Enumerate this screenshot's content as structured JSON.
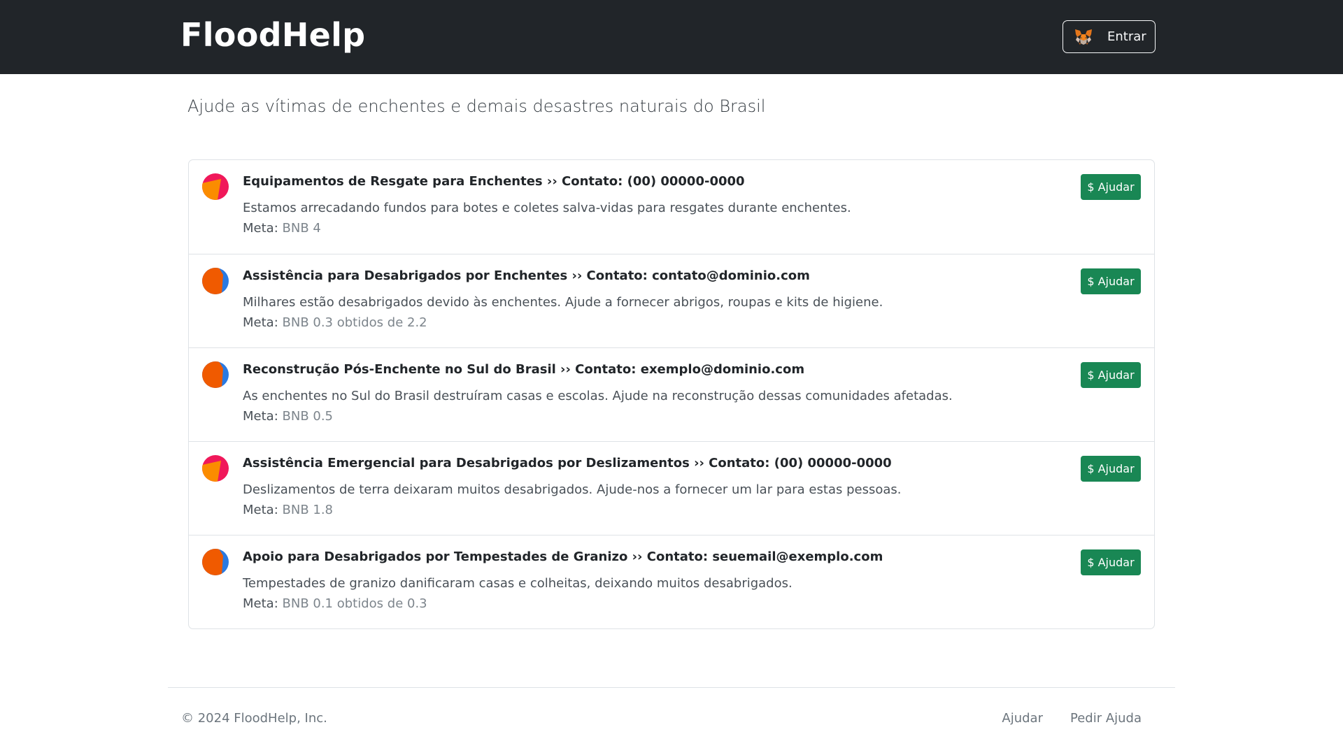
{
  "header": {
    "brand": "FloodHelp",
    "login_label": "Entrar",
    "login_icon": "metamask-fox-icon"
  },
  "tagline": "Ajude as vítimas de enchentes e demais desastres naturais do Brasil",
  "campaigns": [
    {
      "title": "Equipamentos de Resgate para Enchentes ›› Contato: (00) 00000-0000",
      "description": "Estamos arrecadando fundos para botes e coletes salva-vidas para resgates durante enchentes.",
      "goal_label": "Meta:",
      "goal_value": "BNB 4",
      "button_label": "$ Ajudar",
      "avatar_colors": [
        "#f0185a",
        "#fb8c00"
      ]
    },
    {
      "title": "Assistência para Desabrigados por Enchentes ›› Contato: contato@dominio.com",
      "description": "Milhares estão desabrigados devido às enchentes. Ajude a fornecer abrigos, roupas e kits de higiene.",
      "goal_label": "Meta:",
      "goal_value": "BNB 0.3 obtidos de 2.2",
      "button_label": "$ Ajudar",
      "avatar_colors": [
        "#f05a00",
        "#2a7ae2"
      ]
    },
    {
      "title": "Reconstrução Pós-Enchente no Sul do Brasil ›› Contato: exemplo@dominio.com",
      "description": "As enchentes no Sul do Brasil destruíram casas e escolas. Ajude na reconstrução dessas comunidades afetadas.",
      "goal_label": "Meta:",
      "goal_value": "BNB 0.5",
      "button_label": "$ Ajudar",
      "avatar_colors": [
        "#f05a00",
        "#2a7ae2"
      ]
    },
    {
      "title": "Assistência Emergencial para Desabrigados por Deslizamentos ›› Contato: (00) 00000-0000",
      "description": "Deslizamentos de terra deixaram muitos desabrigados. Ajude-nos a fornecer um lar para estas pessoas.",
      "goal_label": "Meta:",
      "goal_value": "BNB 1.8",
      "button_label": "$ Ajudar",
      "avatar_colors": [
        "#f0185a",
        "#fb8c00"
      ]
    },
    {
      "title": "Apoio para Desabrigados por Tempestades de Granizo ›› Contato: seuemail@exemplo.com",
      "description": "Tempestades de granizo danificaram casas e colheitas, deixando muitos desabrigados.",
      "goal_label": "Meta:",
      "goal_value": "BNB 0.1 obtidos de 0.3",
      "button_label": "$ Ajudar",
      "avatar_colors": [
        "#f05a00",
        "#2a7ae2"
      ]
    }
  ],
  "footer": {
    "copyright": "© 2024 FloodHelp, Inc.",
    "links": [
      "Ajudar",
      "Pedir Ajuda"
    ]
  },
  "colors": {
    "header_bg": "#212529",
    "help_button": "#198754"
  }
}
